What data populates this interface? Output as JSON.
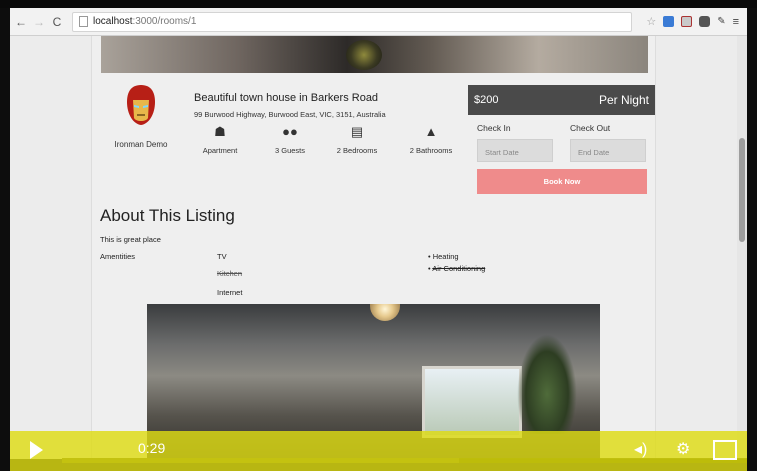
{
  "browser": {
    "url_host": "localhost",
    "url_path": ":3000/rooms/1",
    "back_icon": "back-arrow-icon",
    "forward_icon": "forward-arrow-icon",
    "reload_icon": "reload-icon"
  },
  "listing": {
    "host_name": "Ironman Demo",
    "title": "Beautiful town house in Barkers Road",
    "address": "99 Burwood Highway, Burwood East, VIC, 3151, Australia",
    "features": [
      {
        "icon": "home-icon",
        "label": "Apartment"
      },
      {
        "icon": "guests-icon",
        "label": "3 Guests"
      },
      {
        "icon": "bed-icon",
        "label": "2 Bedrooms"
      },
      {
        "icon": "bath-icon",
        "label": "2 Bathrooms"
      }
    ]
  },
  "booking": {
    "price": "$200",
    "per": "Per Night",
    "check_in_label": "Check In",
    "check_out_label": "Check Out",
    "start_placeholder": "Start Date",
    "end_placeholder": "End Date",
    "book_label": "Book Now"
  },
  "about": {
    "heading": "About This Listing",
    "description": "This is great place",
    "amenities_label": "Amentities",
    "col1": [
      "TV",
      "Kitchen",
      "Internet"
    ],
    "col2": [
      "Heating",
      "Air Conditioning"
    ]
  },
  "player": {
    "time": "0:29",
    "progress": 0.58
  },
  "colors": {
    "book_button": "#ef8b8b",
    "price_bar": "#4a4a4a",
    "player_bar": "#dedc14"
  }
}
